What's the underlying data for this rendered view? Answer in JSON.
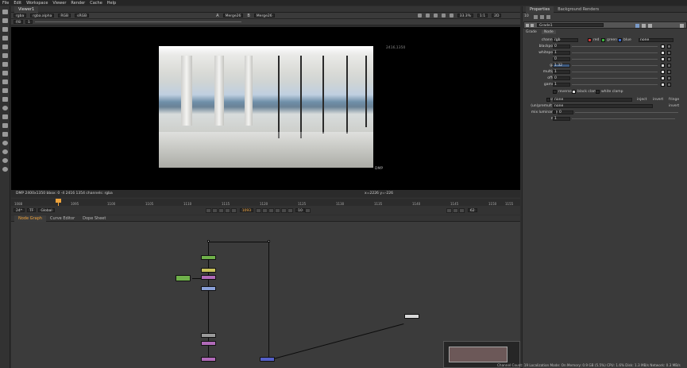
{
  "menu": [
    "File",
    "Edit",
    "Workspace",
    "Viewer",
    "Render",
    "Cache",
    "Help"
  ],
  "viewer": {
    "tab": "Viewer1",
    "channels": "rgba",
    "alpha": "rgba.alpha",
    "colorspace": "RGB",
    "display": "sRGB",
    "input_a_label": "A",
    "input_a": "Merge26",
    "input_b_label": "B",
    "input_b": "Merge26",
    "fstop": "f/8",
    "frame_field": "1",
    "zoom": "33.3%",
    "proxy": "1:1",
    "mode": "2D",
    "resolution_label": "2416,1350",
    "format_label": "DMP",
    "status_left": "DMP 2400x1350  bbox: 0 -4 2416 1354 channels: rgba",
    "status_right": "x=2226 y=-226"
  },
  "timeline": {
    "ticks": [
      "1088",
      "1095",
      "1100",
      "1105",
      "1110",
      "1115",
      "1120",
      "1125",
      "1130",
      "1135",
      "1140",
      "1145",
      "1150",
      "1155"
    ],
    "current_frame": "1093",
    "fps": "24*",
    "tf": "TF",
    "scope": "Global",
    "step": "10",
    "end_value": "62"
  },
  "panels": {
    "tabs": [
      "Node Graph",
      "Curve Editor",
      "Dope Sheet"
    ]
  },
  "properties": {
    "tabs": [
      "Properties",
      "Background Renders"
    ],
    "max_panels": "10",
    "node_name": "Grade1",
    "subtabs": [
      "Grade",
      "Node"
    ],
    "channels_label": "channels",
    "channels_value": "rgb",
    "checks": [
      "red",
      "green",
      "blue"
    ],
    "none_value": "none",
    "params": [
      {
        "label": "blackpoint",
        "value": "0"
      },
      {
        "label": "whitepoint",
        "value": "1"
      },
      {
        "label": "lift",
        "value": "0"
      },
      {
        "label": "gain",
        "value": "1.32"
      },
      {
        "label": "multiply",
        "value": "1"
      },
      {
        "label": "offset",
        "value": "0"
      },
      {
        "label": "gamma",
        "value": "1"
      }
    ],
    "options": [
      "reverse",
      "black clamp",
      "white clamp"
    ],
    "mask_label": "mask",
    "mask_value": "none",
    "inject": "inject",
    "invert": "invert",
    "fringe": "fringe",
    "unpremult_label": "(un)premult by",
    "unpremult_value": "none",
    "invert2": "invert",
    "mixlum_label": "mix luminance",
    "mixlum_value": "0",
    "mix_label": "mix",
    "mix_value": "1"
  },
  "status_bar": "Channel Count: 19  Localization Mode: On  Memory: 0.9 GB (5.5%)  CPU: 1.6%  Disk: 1.3 MB/s  Network: 0.3 MB/s",
  "colors": {
    "grade": "#6fb04a",
    "merge": "#5560c8",
    "transform": "#b06ab8",
    "blur": "#c8c25a",
    "read": "#9a9a9a",
    "accent": "#f0a33a"
  }
}
